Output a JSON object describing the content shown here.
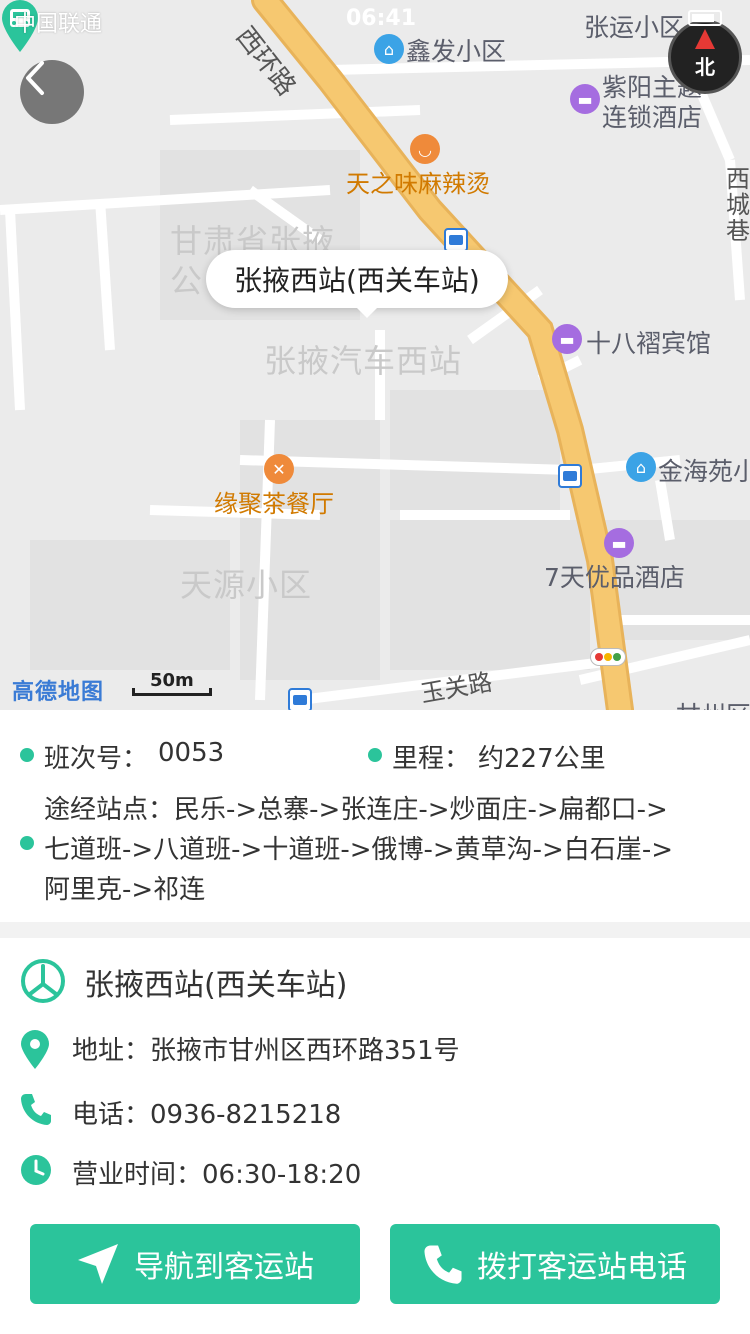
{
  "status_bar": {
    "carrier": "中国联通",
    "time": "06:41"
  },
  "map": {
    "roads": {
      "west_ring": "西环路",
      "yuguan": "玉关路",
      "xicheng": "西城巷"
    },
    "areas": {
      "gansu_gov": "甘肃省张掖",
      "gansu_gov2": "公",
      "bus_west_station": "张掖汽车西站",
      "tianyuan": "天源小区",
      "xinfa": "鑫发小区",
      "zhangyun": "张运小区",
      "jinhaiyuan": "金海苑小"
    },
    "pois": {
      "ziyang_hotel_line1": "紫阳主题",
      "ziyang_hotel_line2": "连锁酒店",
      "tianzhiwei": "天之味麻辣烫",
      "shibazhe": "十八褶宾馆",
      "yuanju": "缘聚茶餐厅",
      "seven_days": "7天优品酒店",
      "ganzhou_partial": "甘州区"
    },
    "callout": "张掖西站(西关车站)",
    "logo": "高德地图",
    "scale": "50m",
    "compass": "北"
  },
  "info": {
    "trip_label": "班次号：",
    "trip_value": "0053",
    "distance_label": "里程：",
    "distance_value": "约227公里",
    "route_line1": "途经站点：民乐->总寨->张连庄->炒面庄->扁都口->",
    "route_line2": "七道班->八道班->十道班->俄博->黄草沟->白石崖->",
    "route_line3": "阿里克->祁连"
  },
  "station": {
    "name": "张掖西站(西关车站)",
    "address": "地址：张掖市甘州区西环路351号",
    "phone": "电话：0936-8215218",
    "hours": "营业时间：06:30-18:20"
  },
  "buttons": {
    "navigate": "导航到客运站",
    "call": "拨打客运站电话"
  },
  "colors": {
    "accent": "#2bc49b",
    "road": "#f6c870"
  }
}
